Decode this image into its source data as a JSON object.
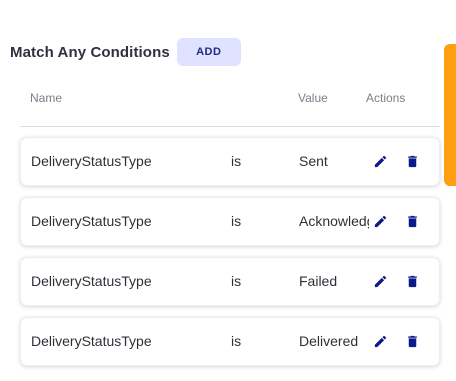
{
  "conditions": {
    "title": "Match Any Conditions",
    "add_label": "ADD",
    "columns": {
      "name": "Name",
      "value": "Value",
      "actions": "Actions"
    },
    "rows": [
      {
        "name": "DeliveryStatusType",
        "operator": "is",
        "value": "Sent"
      },
      {
        "name": "DeliveryStatusType",
        "operator": "is",
        "value": "Acknowledged"
      },
      {
        "name": "DeliveryStatusType",
        "operator": "is",
        "value": "Failed"
      },
      {
        "name": "DeliveryStatusType",
        "operator": "is",
        "value": "Delivered"
      }
    ]
  },
  "icons": {
    "edit": "pencil-icon",
    "delete": "trash-icon"
  },
  "colors": {
    "accent": "#0d1a8c",
    "add_button_bg": "#dfe3ff",
    "side_tab": "#ff9e0f"
  }
}
